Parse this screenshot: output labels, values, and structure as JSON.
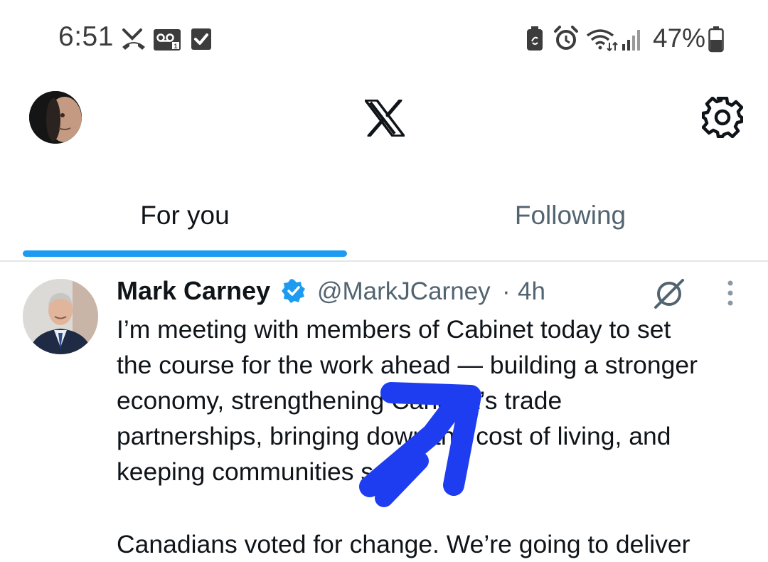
{
  "status_bar": {
    "time": "6:51",
    "battery_percent": "47%",
    "icons": [
      "missed-call-icon",
      "voicemail-icon",
      "checkbox-icon",
      "battery-saver-icon",
      "alarm-icon",
      "wifi-icon",
      "signal-icon",
      "battery-icon"
    ]
  },
  "header": {
    "logo": "X",
    "avatar": "profile-avatar",
    "settings_icon": "gear-icon"
  },
  "tabs": [
    {
      "label": "For you",
      "active": true
    },
    {
      "label": "Following",
      "active": false
    }
  ],
  "tweet": {
    "author_name": "Mark Carney",
    "handle": "@MarkJCarney",
    "separator": "·",
    "time": "4h",
    "verified": true,
    "text": "I’m meeting with members of Cabinet today to set\nthe course for the work ahead — building a stronger\neconomy, strengthening Canada’s trade\npartnerships, bringing down the cost of living, and\nkeeping communities safe.",
    "text_continued": "Canadians voted for change. We’re going to deliver"
  },
  "colors": {
    "accent": "#1d9bf0",
    "secondary_text": "#536471",
    "annotation_arrow": "#1f3df0"
  }
}
